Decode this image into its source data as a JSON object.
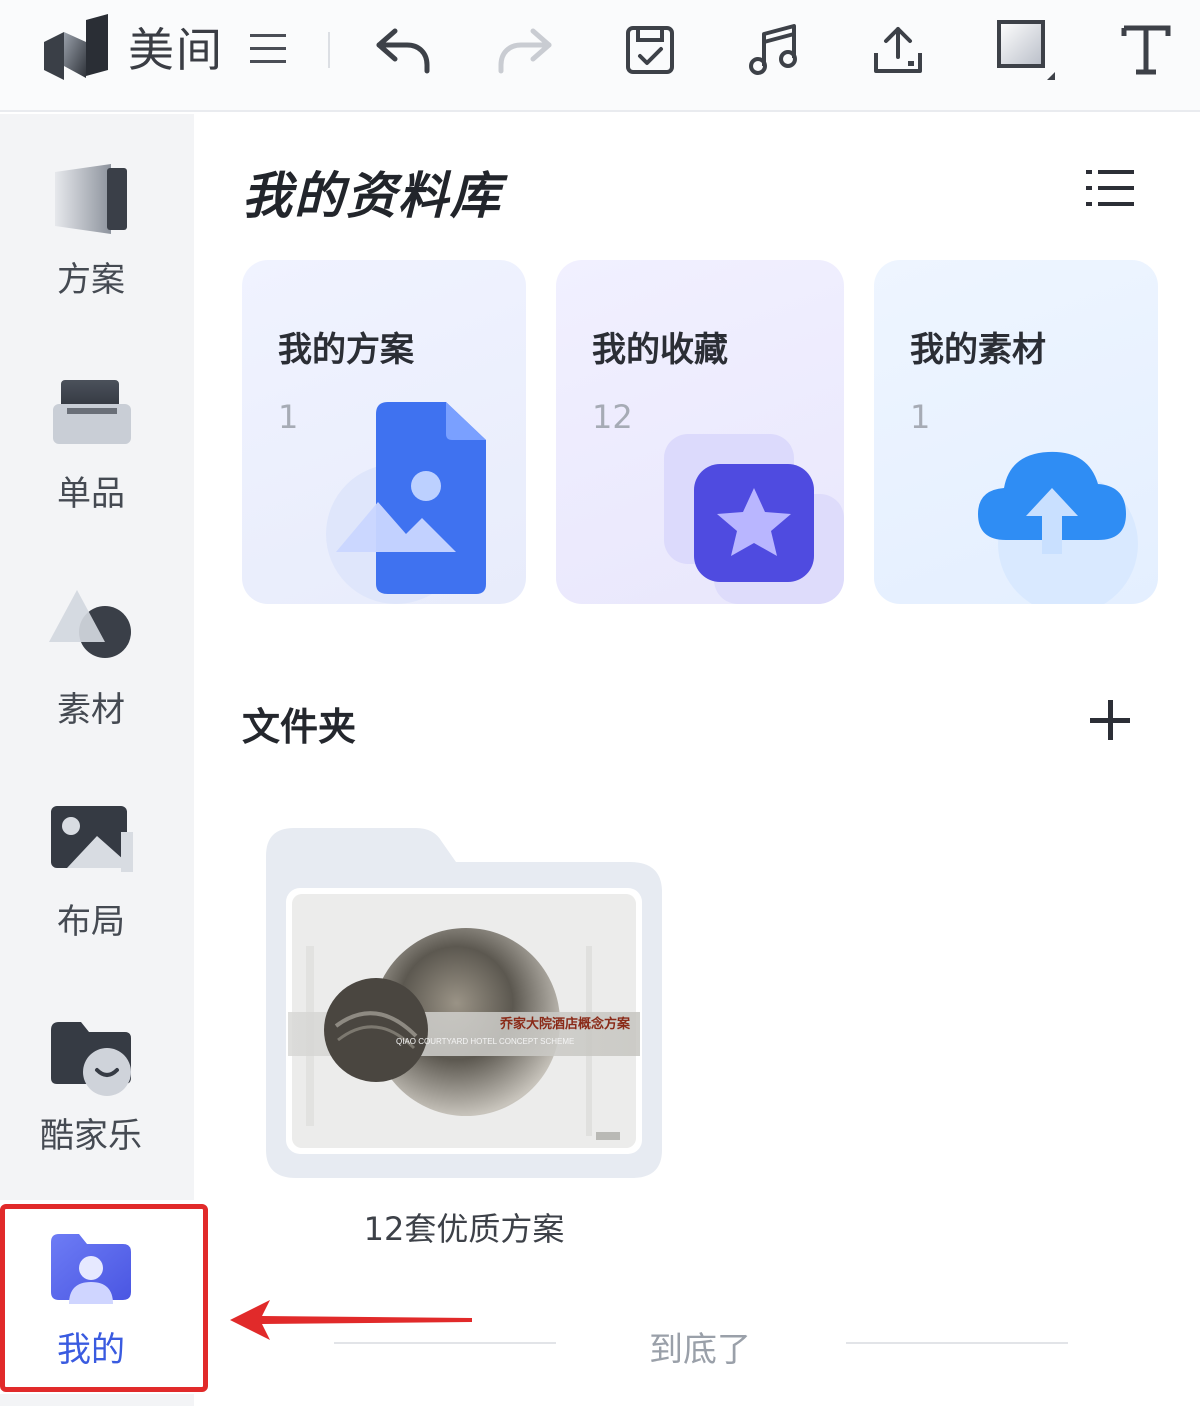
{
  "app": {
    "title": "美间"
  },
  "toolbar": {
    "buttons": [
      {
        "name": "undo-icon"
      },
      {
        "name": "redo-icon"
      },
      {
        "name": "save-icon"
      },
      {
        "name": "music-icon"
      },
      {
        "name": "upload-icon"
      },
      {
        "name": "shape-icon"
      },
      {
        "name": "text-icon"
      }
    ]
  },
  "sidebar": {
    "items": [
      {
        "label": "方案",
        "icon": "plan-icon",
        "active": false
      },
      {
        "label": "单品",
        "icon": "product-icon",
        "active": false
      },
      {
        "label": "素材",
        "icon": "material-icon",
        "active": false
      },
      {
        "label": "布局",
        "icon": "layout-icon",
        "active": false
      },
      {
        "label": "酷家乐",
        "icon": "kujiale-icon",
        "active": false
      },
      {
        "label": "我的",
        "icon": "my-icon",
        "active": true
      }
    ]
  },
  "library": {
    "title": "我的资料库",
    "cards": [
      {
        "title": "我的方案",
        "count": "1",
        "icon": "image-file-icon"
      },
      {
        "title": "我的收藏",
        "count": "12",
        "icon": "star-icon"
      },
      {
        "title": "我的素材",
        "count": "1",
        "icon": "cloud-upload-icon"
      }
    ]
  },
  "folders": {
    "title": "文件夹",
    "items": [
      {
        "name": "12套优质方案",
        "thumb_caption": "乔家大院酒店概念方案",
        "thumb_sub": "QIAO COURTYARD HOTEL CONCEPT SCHEME"
      }
    ]
  },
  "footer": {
    "end_text": "到底了"
  },
  "colors": {
    "accent": "#3a5be0",
    "highlight": "#e12a2a"
  }
}
